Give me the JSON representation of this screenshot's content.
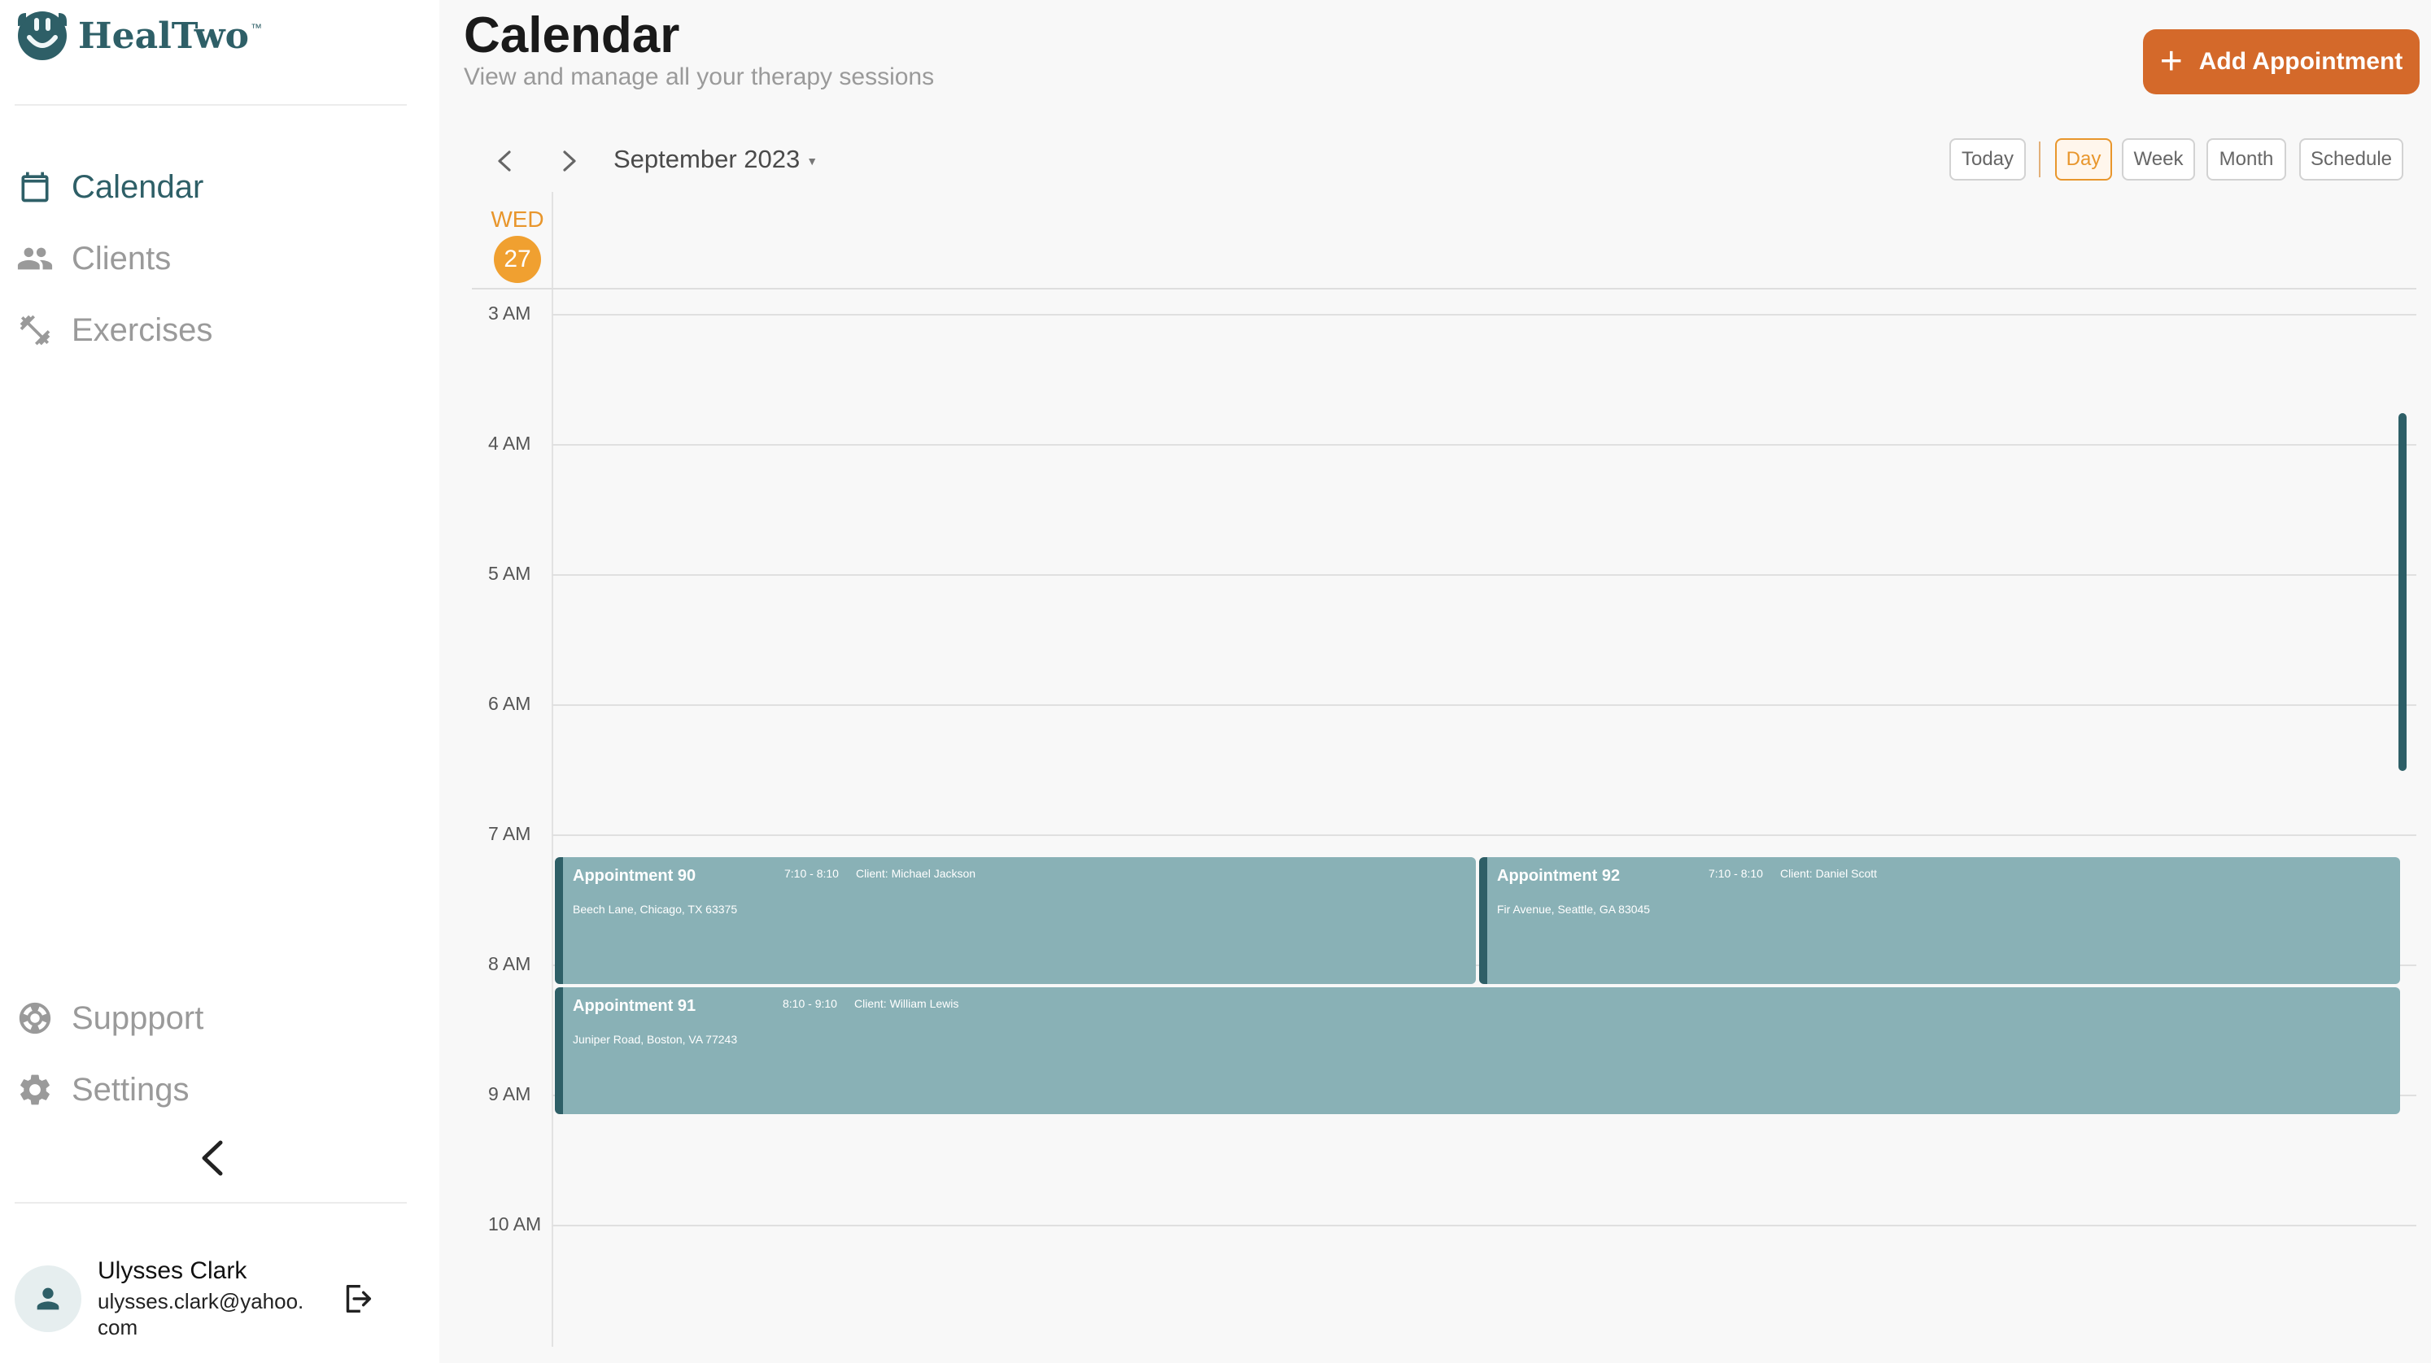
{
  "brand": {
    "name": "HealTwo",
    "tm": "™",
    "color": "#2e5f67"
  },
  "sidebar": {
    "nav": [
      {
        "label": "Calendar",
        "icon": "calendar-icon",
        "active": true
      },
      {
        "label": "Clients",
        "icon": "people-icon",
        "active": false
      },
      {
        "label": "Exercises",
        "icon": "exercise-icon",
        "active": false
      }
    ],
    "bottom": [
      {
        "label": "Suppport",
        "icon": "support-icon"
      },
      {
        "label": "Settings",
        "icon": "gear-icon"
      }
    ],
    "user": {
      "name": "Ulysses Clark",
      "email": "ulysses.clark@yahoo.com"
    }
  },
  "header": {
    "title": "Calendar",
    "subtitle": "View and manage all your therapy sessions",
    "add_button": "Add Appointment",
    "accent": "#d4692a"
  },
  "toolbar": {
    "month": "September 2023",
    "views": [
      "Today",
      "Day",
      "Week",
      "Month",
      "Schedule"
    ],
    "active_view": "Day"
  },
  "day": {
    "name": "WED",
    "number": "27"
  },
  "hours": [
    "3 AM",
    "4 AM",
    "5 AM",
    "6 AM",
    "7 AM",
    "8 AM",
    "9 AM",
    "10 AM"
  ],
  "appointments": [
    {
      "title": "Appointment 90",
      "time": "7:10 - 8:10",
      "client": "Client: Michael Jackson",
      "address": "Beech Lane, Chicago, TX 63375"
    },
    {
      "title": "Appointment 92",
      "time": "7:10 - 8:10",
      "client": "Client: Daniel Scott",
      "address": "Fir Avenue, Seattle, GA 83045"
    },
    {
      "title": "Appointment 91",
      "time": "8:10 - 9:10",
      "client": "Client: William Lewis",
      "address": "Juniper Road, Boston, VA 77243"
    }
  ]
}
